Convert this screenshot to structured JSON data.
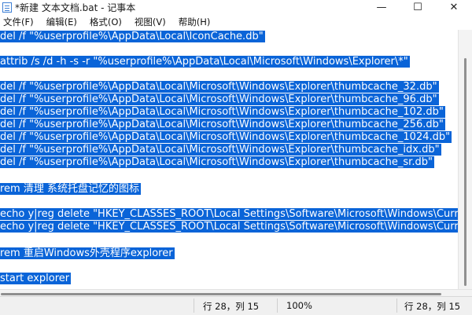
{
  "window": {
    "title": "*新建 文本文档.bat - 记事本",
    "minimize_glyph": "—",
    "maximize_glyph": "☐",
    "close_glyph": "✕",
    "icon": "notepad-icon"
  },
  "menu": [
    "文件(F)",
    "编辑(E)",
    "格式(O)",
    "视图(V)",
    "帮助(H)"
  ],
  "editor": {
    "lines": [
      "del /f \"%userprofile%\\AppData\\Local\\IconCache.db\"",
      "attrib /s /d -h -s -r \"%userprofile%\\AppData\\Local\\Microsoft\\Windows\\Explorer\\*\"",
      "del /f \"%userprofile%\\AppData\\Local\\Microsoft\\Windows\\Explorer\\thumbcache_32.db\"",
      "del /f \"%userprofile%\\AppData\\Local\\Microsoft\\Windows\\Explorer\\thumbcache_96.db\"",
      "del /f \"%userprofile%\\AppData\\Local\\Microsoft\\Windows\\Explorer\\thumbcache_102.db\"",
      "del /f \"%userprofile%\\AppData\\Local\\Microsoft\\Windows\\Explorer\\thumbcache_256.db\"",
      "del /f \"%userprofile%\\AppData\\Local\\Microsoft\\Windows\\Explorer\\thumbcache_1024.db\"",
      "del /f \"%userprofile%\\AppData\\Local\\Microsoft\\Windows\\Explorer\\thumbcache_idx.db\"",
      "del /f \"%userprofile%\\AppData\\Local\\Microsoft\\Windows\\Explorer\\thumbcache_sr.db\"",
      "rem 清理 系统托盘记忆的图标",
      "echo y|reg delete \"HKEY_CLASSES_ROOT\\Local Settings\\Software\\Microsoft\\Windows\\CurrentVersion\\TrayNotify\" /v IconStreams",
      "echo y|reg delete \"HKEY_CLASSES_ROOT\\Local Settings\\Software\\Microsoft\\Windows\\CurrentVersion\\TrayNotify\" /v PastIconsStream",
      "rem 重启Windows外壳程序explorer",
      "start explorer"
    ],
    "selection_color": "#0a64d8"
  },
  "status": {
    "position_left": "行 28，列 15",
    "zoom": "100%",
    "position_right": "行 28，列 15"
  }
}
